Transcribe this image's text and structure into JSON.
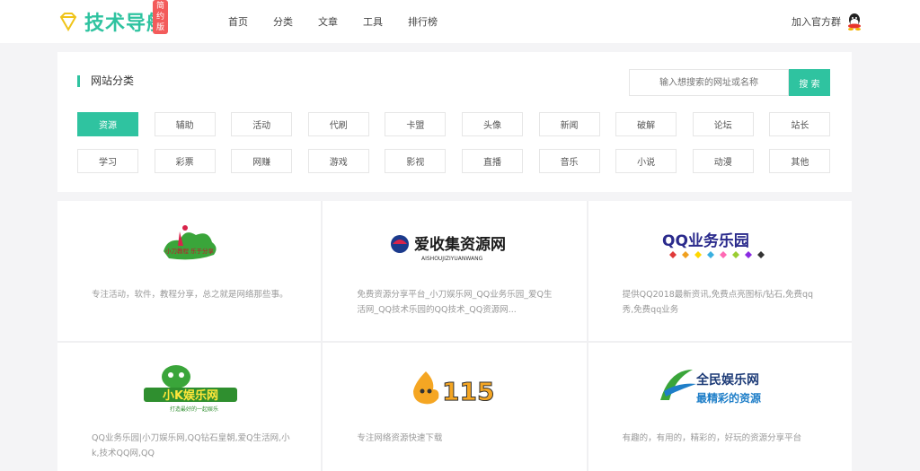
{
  "header": {
    "logo_text": "技术导航",
    "logo_badge": "简约版",
    "nav": [
      "首页",
      "分类",
      "文章",
      "工具",
      "排行榜"
    ],
    "join_label": "加入官方群"
  },
  "panel": {
    "title": "网站分类",
    "search_placeholder": "输入想搜索的网址或名称",
    "search_button": "搜 索",
    "tags": [
      "资源",
      "辅助",
      "活动",
      "代刷",
      "卡盟",
      "头像",
      "新闻",
      "破解",
      "论坛",
      "站长",
      "学习",
      "彩票",
      "网赚",
      "游戏",
      "影视",
      "直播",
      "音乐",
      "小说",
      "动漫",
      "其他"
    ],
    "active_tag": "资源"
  },
  "sites": [
    {
      "logo_text": "小刀教程 乐于分享",
      "desc": "专注活动，软件，教程分享，总之就是网络那些事。"
    },
    {
      "logo_text": "爱收集资源网",
      "logo_sub": "AISHOUJIZIYUANWANG",
      "desc": "免费资源分享平台_小刀娱乐网_QQ业务乐园_爱Q生活网_QQ技术乐园的QQ技术_QQ资源网..."
    },
    {
      "logo_text": "QQ业务乐园",
      "desc": "提供QQ2018最新资讯,免费点亮图标/钻石,免费qq秀,免费qq业务"
    },
    {
      "logo_text": "小K娱乐网",
      "logo_sub": "打造最好的一起娱乐",
      "desc": "QQ业务乐园|小刀娱乐网,QQ钻石皇朝,爱Q生活网,小k,技术QQ网,QQ"
    },
    {
      "logo_text": "115",
      "desc": "专注网络资源快速下载"
    },
    {
      "logo_text": "全民娱乐网",
      "logo_sub": "最精彩的资源",
      "desc": "有趣的，有用的，精彩的，好玩的资源分享平台"
    }
  ],
  "colors": {
    "accent": "#2fc3a0",
    "badge": "#f35b5b"
  }
}
